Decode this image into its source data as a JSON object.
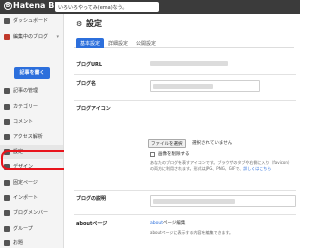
{
  "topbar": {
    "logo": "Hatena Blog",
    "blog_title": "いろいろやってみ(ema)なう。"
  },
  "sidebar": {
    "write_button": "記事を書く",
    "items": [
      {
        "label": "ダッシュボード",
        "icon": "dashboard-icon"
      },
      {
        "label": "編集中のブログ",
        "icon": "blog-icon"
      },
      {
        "label": "記事の管理",
        "icon": "article-icon"
      },
      {
        "label": "カテゴリー",
        "icon": "folder-icon"
      },
      {
        "label": "コメント",
        "icon": "comment-icon"
      },
      {
        "label": "アクセス解析",
        "icon": "chart-icon"
      },
      {
        "label": "設定",
        "icon": "gear-icon"
      },
      {
        "label": "デザイン",
        "icon": "palette-icon"
      },
      {
        "label": "固定ページ",
        "icon": "page-icon"
      },
      {
        "label": "インポート",
        "icon": "import-icon"
      },
      {
        "label": "ブログメンバー",
        "icon": "members-icon"
      },
      {
        "label": "グループ",
        "icon": "group-icon"
      },
      {
        "label": "お題",
        "icon": "topic-icon"
      }
    ]
  },
  "main": {
    "title": "設定",
    "tabs": [
      "基本設定",
      "詳細設定",
      "公開設定"
    ],
    "rows": {
      "blog_url": "ブログURL",
      "blog_name": "ブログ名",
      "blog_icon": "ブログアイコン",
      "description": "ブログの説明",
      "about": "aboutページ"
    },
    "file_button": "ファイルを選択",
    "file_status": "選択されていません",
    "checkbox_label": "画像を削除する",
    "icon_help": "あなたのブログを表すアイコンです。ブラウザのタブや右側に入り（favicon）の両方に利用されます。形式はJPG、PNG、GIFで、",
    "icon_help_link": "詳しくはこちら",
    "about_link": "about",
    "about_link_suffix": "ページ編集",
    "about_help": "aboutページに表示する内容を編集できます。"
  },
  "colors": {
    "accent": "#2c6fdc",
    "highlight": "#e8141c",
    "topbar": "#3b3b3b"
  }
}
